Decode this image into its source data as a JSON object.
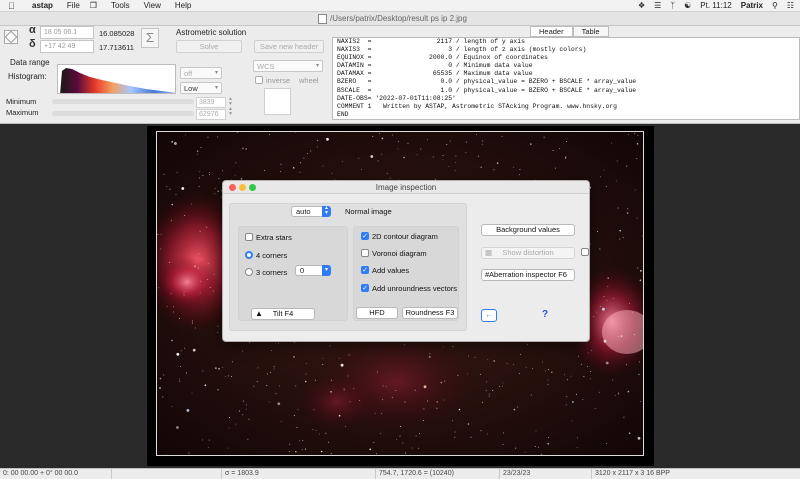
{
  "menubar": {
    "app_name": "astap",
    "menus": [
      "File",
      "Tools",
      "View",
      "Help"
    ],
    "clock": "Pt. 11:12",
    "user": "Patrix"
  },
  "window": {
    "title": "/Users/patrix/Desktop/result ps ip 2.jpg"
  },
  "coordinates": {
    "alpha_symbol": "α",
    "delta_symbol": "δ",
    "ra_input": "18 05 06.1",
    "dec_input": "+17 42 49",
    "ra_value": "16.085028",
    "dec_value": "17.713611",
    "sigma": "Σ"
  },
  "astrometric": {
    "label": "Astrometric solution",
    "solve_button": "Solve",
    "save_header_button": "Save new header"
  },
  "data_range": {
    "label": "Data range",
    "histogram_label": "Histogram:",
    "stretch_select": "off",
    "low_select": "Low",
    "wcs_select": "WCS",
    "inverse_label": "inverse",
    "wheel_label": "wheel",
    "minimum_label": "Minimum",
    "maximum_label": "Maximum",
    "minimum_value": "3839",
    "maximum_value": "62976"
  },
  "header_tabs": {
    "header": "Header",
    "table": "Table"
  },
  "fits_header": [
    "NAXIS2  =                 2117 / length of y axis",
    "NAXIS3  =                    3 / length of z axis (mostly colors)",
    "EQUINOX =               2000.0 / Equinox of coordinates",
    "DATAMIN =                    0 / Minimum data value",
    "DATAMAX =                65535 / Maximum data value",
    "BZERO   =                  0.0 / physical_value = BZERO + BSCALE * array_value",
    "BSCALE  =                  1.0 / physical_value = BZERO + BSCALE * array_value",
    "DATE-OBS= '2022-07-01T11:08:25'",
    "COMMENT 1   Written by ASTAP, Astrometric STAcking Program. www.hnsky.org",
    "END"
  ],
  "dialog": {
    "title": "Image inspection",
    "mode_select": "auto",
    "mode_label": "Normal image",
    "extra_stars": "Extra stars",
    "four_corners": "4 corners",
    "three_corners": "3 corners",
    "three_corners_select": "0",
    "tilt_button": "Tilt    F4",
    "contour_2d": "2D contour diagram",
    "voronoi": "Voronoi diagram",
    "add_values": "Add values",
    "add_unroundness": "Add unroundness vectors",
    "hfd_button": "HFD",
    "roundness_button": "Roundness  F3",
    "background_values": "Background values",
    "show_distortion": "Show distortion",
    "aberration_inspector": "Aberration inspector  F6",
    "help": "?"
  },
  "statusbar": {
    "cell1": "0: 00  00.00   + 0° 00  00.0",
    "cell2": "",
    "cell3": "σ = 1803.9",
    "cell4": "754.7, 1720.6 = (10240)",
    "cell5": "23/23/23",
    "cell6": "3120 x 2117 x 3  16 BPP"
  }
}
